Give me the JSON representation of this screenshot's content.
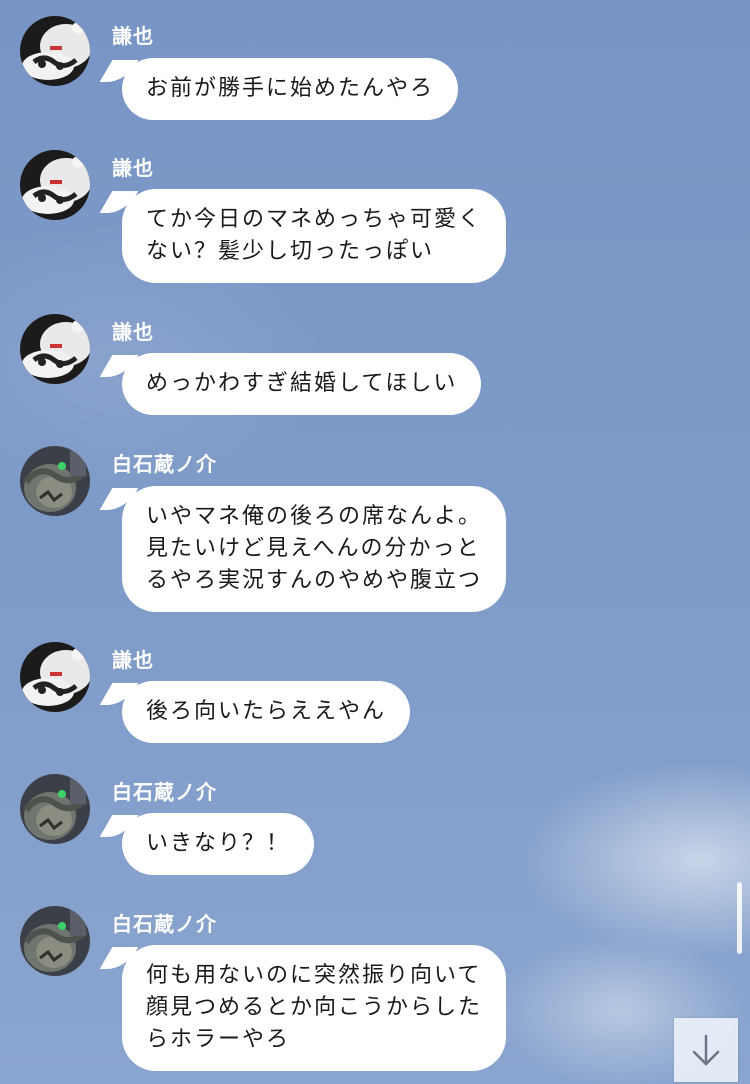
{
  "messages": [
    {
      "sender": "謙也",
      "avatar": "kenya-avatar",
      "lines": [
        "お前が勝手に始めたんやろ"
      ]
    },
    {
      "sender": "謙也",
      "avatar": "kenya-avatar",
      "lines": [
        "てか今日のマネめっちゃ可愛く",
        "ない？髪少し切ったっぽい"
      ]
    },
    {
      "sender": "謙也",
      "avatar": "kenya-avatar",
      "lines": [
        "めっかわすぎ結婚してほしい"
      ]
    },
    {
      "sender": "白石蔵ノ介",
      "avatar": "shiraishi-avatar",
      "lines": [
        "いやマネ俺の後ろの席なんよ。",
        "見たいけど見えへんの分かっと",
        "るやろ実況すんのやめや腹立つ"
      ]
    },
    {
      "sender": "謙也",
      "avatar": "kenya-avatar",
      "lines": [
        "後ろ向いたらええやん"
      ]
    },
    {
      "sender": "白石蔵ノ介",
      "avatar": "shiraishi-avatar",
      "lines": [
        "いきなり？！"
      ]
    },
    {
      "sender": "白石蔵ノ介",
      "avatar": "shiraishi-avatar",
      "lines": [
        "何も用ないのに突然振り向いて",
        "顔見つめるとか向こうからした",
        "らホラーやろ"
      ]
    }
  ],
  "controls": {
    "scroll_down_icon": "arrow-down-icon"
  },
  "colors": {
    "background": "#7b97c4",
    "bubble": "#ffffff",
    "text": "#1a1a1a",
    "sender_name": "#ffffff"
  }
}
